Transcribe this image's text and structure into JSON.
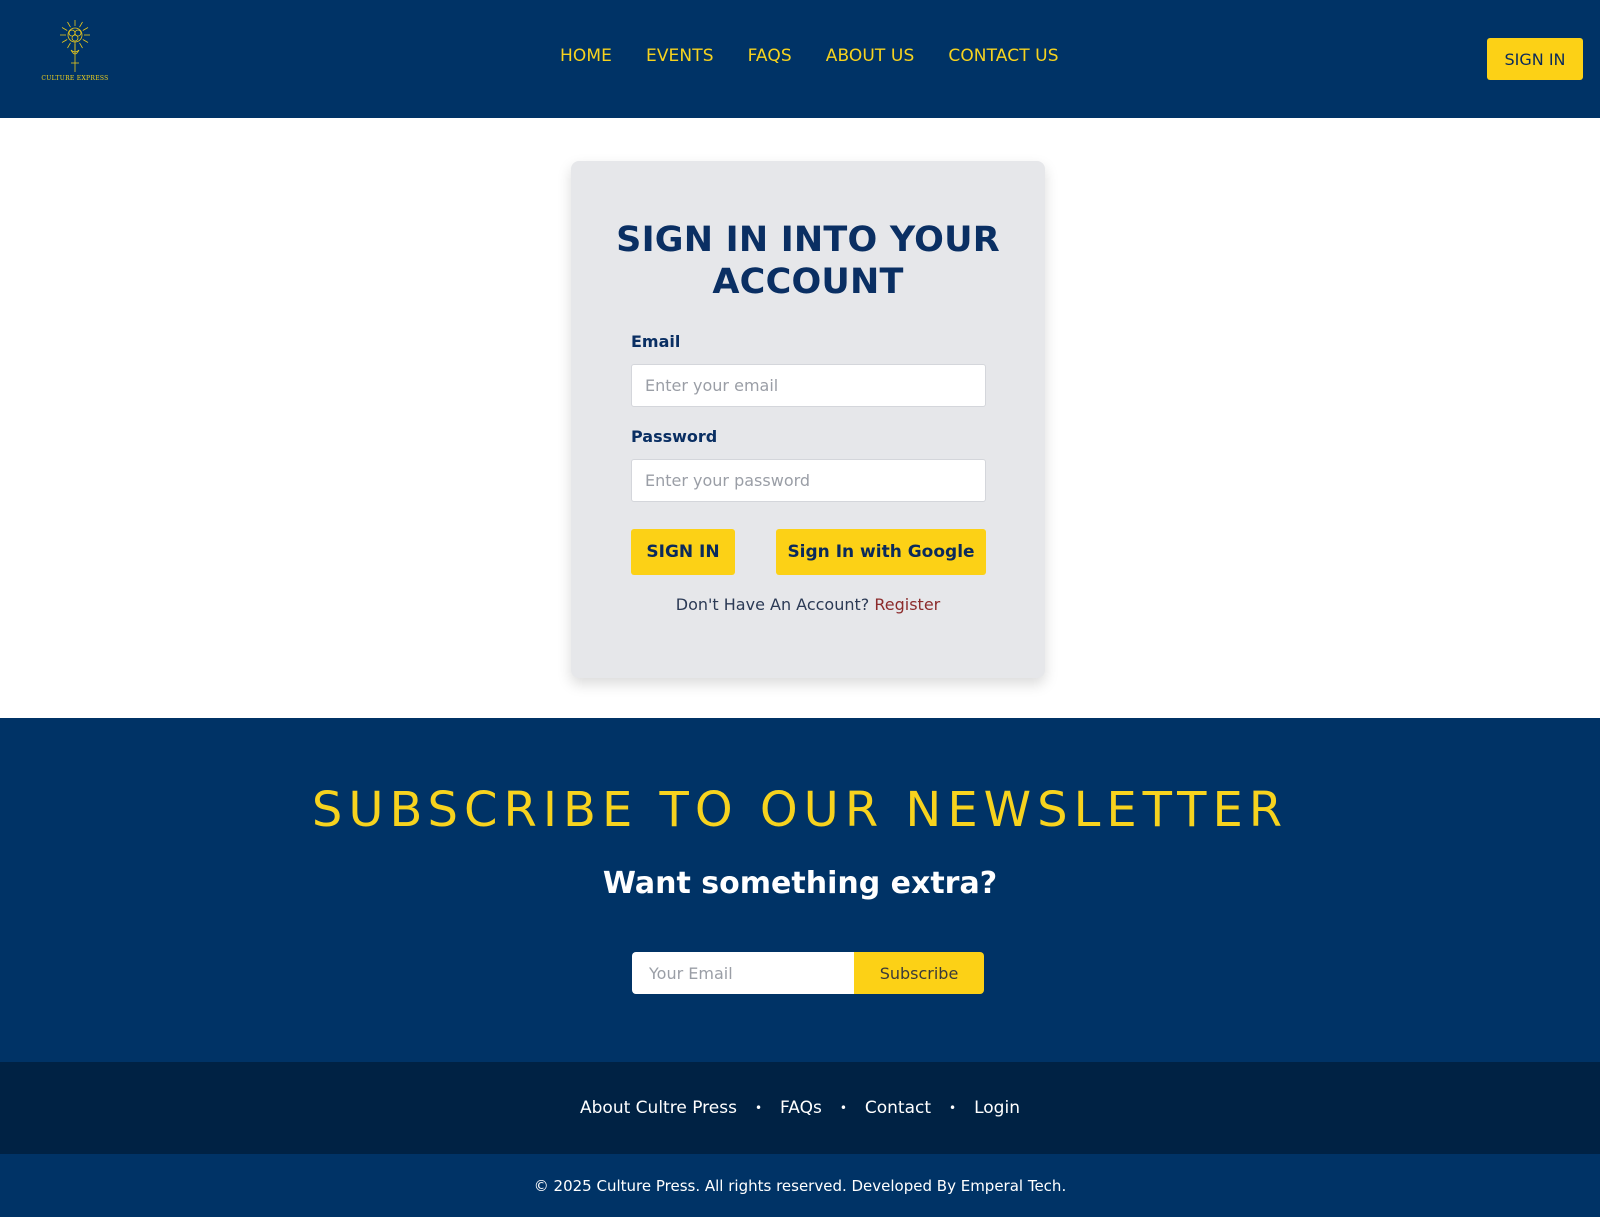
{
  "header": {
    "logo_text": "CULTURE EXPRESS",
    "nav": [
      {
        "label": "HOME"
      },
      {
        "label": "EVENTS"
      },
      {
        "label": "FAQS"
      },
      {
        "label": "ABOUT US"
      },
      {
        "label": "CONTACT US"
      }
    ],
    "signin_label": "SIGN IN"
  },
  "login": {
    "title": "SIGN IN INTO YOUR ACCOUNT",
    "email_label": "Email",
    "email_placeholder": "Enter your email",
    "email_value": "",
    "password_label": "Password",
    "password_placeholder": "Enter your password",
    "password_value": "",
    "signin_button": "SIGN IN",
    "google_button": "Sign In with Google",
    "no_account_text": "Don't Have An Account?",
    "register_link": "Register"
  },
  "newsletter": {
    "title": "SUBSCRIBE TO OUR NEWSLETTER",
    "subtitle": "Want something extra?",
    "email_placeholder": "Your Email",
    "subscribe_button": "Subscribe"
  },
  "footer": {
    "links": [
      {
        "label": "About Cultre Press"
      },
      {
        "label": "FAQs"
      },
      {
        "label": "Contact"
      },
      {
        "label": "Login"
      }
    ],
    "separator": "•",
    "copyright": "© 2025 Culture Press. All rights reserved. Developed By Emperal Tech."
  },
  "colors": {
    "navy": "#003366",
    "dark_navy": "#002244",
    "yellow": "#fcd116",
    "card_bg": "#e6e7ea",
    "register_red": "#8c2b2b"
  }
}
